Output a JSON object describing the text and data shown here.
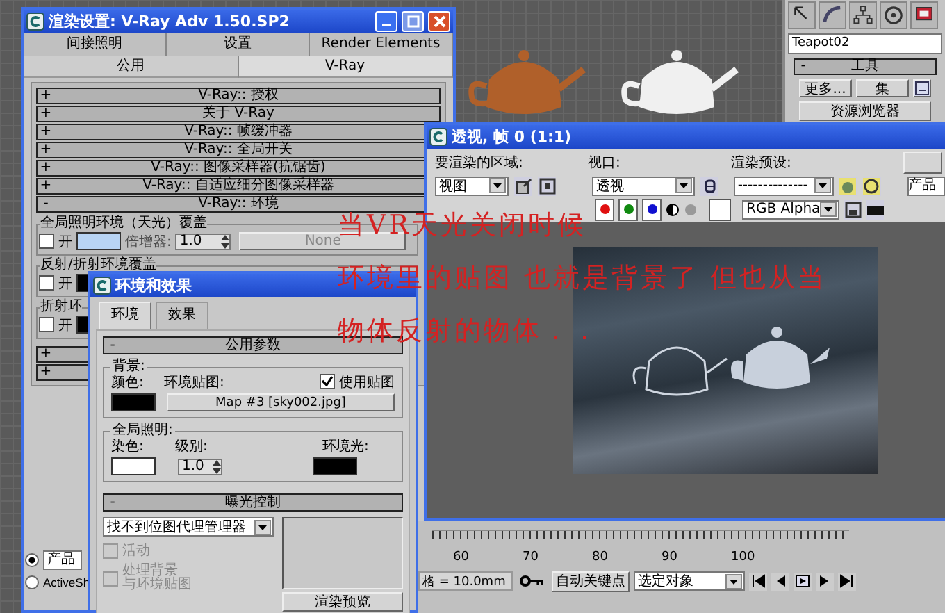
{
  "command_panel": {
    "object_name": "Teapot02",
    "rollout": {
      "toggle": "-",
      "title": "工具"
    },
    "buttons": [
      "更多...",
      "集"
    ],
    "wide_button": "资源浏览器"
  },
  "render_setup": {
    "title": "渲染设置: V-Ray Adv 1.50.SP2",
    "tabs_back": [
      {
        "label": "间接照明",
        "selected": false
      },
      {
        "label": "设置",
        "selected": false
      },
      {
        "label": "Render Elements",
        "selected": false
      }
    ],
    "tabs_front": [
      {
        "label": "公用",
        "selected": false
      },
      {
        "label": "V-Ray",
        "selected": true
      }
    ],
    "rollouts": [
      {
        "toggle": "+",
        "title": "V-Ray:: 授权"
      },
      {
        "toggle": "+",
        "title": "关于 V-Ray"
      },
      {
        "toggle": "+",
        "title": "V-Ray:: 帧缓冲器"
      },
      {
        "toggle": "+",
        "title": "V-Ray:: 全局开关"
      },
      {
        "toggle": "+",
        "title": "V-Ray:: 图像采样器(抗锯齿)"
      },
      {
        "toggle": "+",
        "title": "V-Ray:: 自适应细分图像采样器"
      },
      {
        "toggle": "-",
        "title": "V-Ray:: 环境"
      }
    ],
    "env_groups": [
      {
        "title": "全局照明环境（天光）覆盖",
        "on_label": "开",
        "checked": false,
        "color": "#b8d4f4",
        "multiplier_label": "倍增器:",
        "multiplier": "1.0",
        "map": "None"
      },
      {
        "title": "反射/折射环境覆盖",
        "on_label": "开",
        "checked": false,
        "color": "#000000"
      },
      {
        "title": "折射环",
        "on_label": "开",
        "checked": false,
        "color": "#000000"
      }
    ],
    "more_rollouts": [
      {
        "toggle": "+"
      },
      {
        "toggle": "+"
      }
    ],
    "render_mode": [
      {
        "label": "产品",
        "kind": "field",
        "selected": true
      },
      {
        "label": "ActiveSh",
        "kind": "label",
        "selected": false
      }
    ]
  },
  "env_effects": {
    "title": "环境和效果",
    "tabs": [
      {
        "label": "环境",
        "selected": true
      },
      {
        "label": "效果",
        "selected": false
      }
    ],
    "common": {
      "toggle": "-",
      "title": "公用参数",
      "background_label": "背景:",
      "bg": {
        "label": "颜色:",
        "color": "#000000"
      },
      "map_label": "环境贴图:",
      "use_map": {
        "label": "使用贴图",
        "checked": true
      },
      "map_button": "Map #3 [sky002.jpg]",
      "gi_label": "全局照明:",
      "tint": {
        "label": "染色:",
        "color": "#ffffff"
      },
      "level_label": "级别:",
      "level_value": "1.0",
      "ambient": {
        "label": "环境光:",
        "color": "#000000"
      }
    },
    "exposure": {
      "toggle": "-",
      "title": "曝光控制",
      "dropdown": "找不到位图代理管理器",
      "active": {
        "label": "活动",
        "checked": false,
        "disabled": true
      },
      "process": {
        "lines": [
          "处理背景",
          "与环境贴图"
        ],
        "checked": false,
        "disabled": true
      },
      "preview_button": "渲染预览"
    }
  },
  "frame_window": {
    "title": "透视, 帧 0 (1:1)",
    "area_label": "要渲染的区域:",
    "area": "视图",
    "viewport_label": "视口:",
    "viewport": "透视",
    "preset_label": "渲染预设:",
    "preset": "--------------",
    "render_field": "产品",
    "channels": [
      {
        "color": "#e01010",
        "on": true
      },
      {
        "color": "#108a10",
        "on": true
      },
      {
        "color": "#1010d0",
        "on": true
      }
    ],
    "display": "RGB Alpha"
  },
  "annotation": [
    "当VR天光关闭时候",
    "环境里的贴图 也就是背景了 但也从当",
    "物体反射的物体．．"
  ],
  "timeline": {
    "ticks": [
      "60",
      "70",
      "80",
      "90",
      "100"
    ]
  },
  "status": {
    "grid": "格 = 10.0mm",
    "auto_key": "自动关键点",
    "selection": "选定对象"
  }
}
